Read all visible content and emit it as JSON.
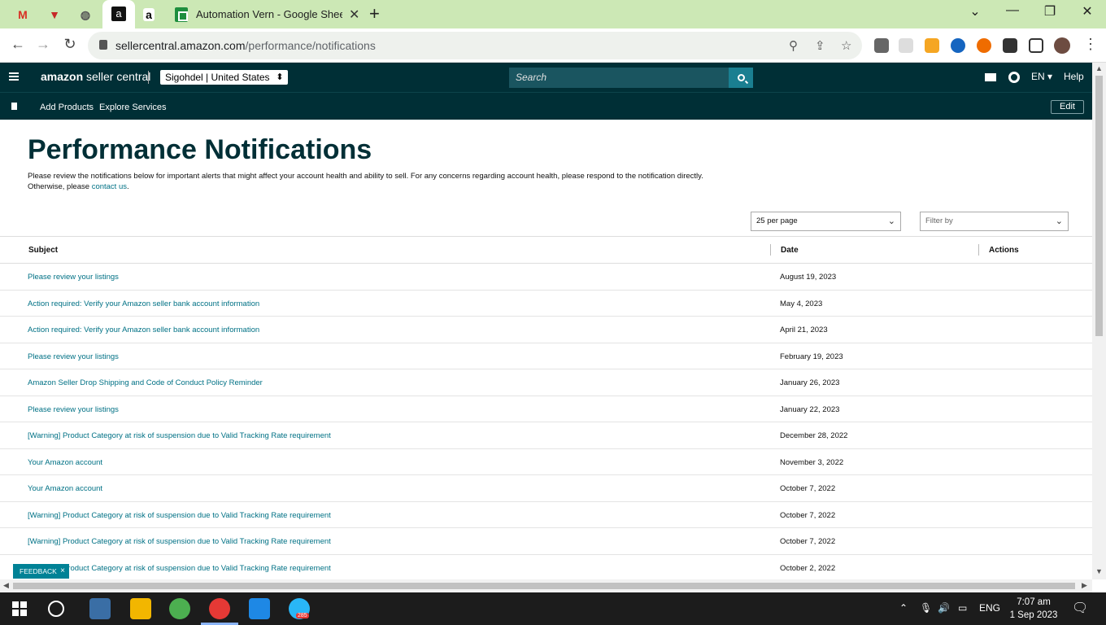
{
  "browser": {
    "tabs": [
      {
        "label": "M"
      },
      {
        "label": "▼"
      },
      {
        "label": "◍"
      },
      {
        "label": "a"
      },
      {
        "label": "a"
      },
      {
        "label": "Automation Vern - Google Sheets"
      }
    ],
    "url_host": "sellercentral.amazon.com",
    "url_path": "/performance/notifications"
  },
  "header": {
    "logo_main": "amazon",
    "logo_sub": " seller central",
    "account": "Sigohdel | United States",
    "search_placeholder": "Search",
    "language": "EN ▾",
    "help": "Help"
  },
  "nav": {
    "items": [
      "Add Products",
      "Explore Services"
    ],
    "edit": "Edit"
  },
  "page": {
    "title": "Performance Notifications",
    "intro": "Please review the notifications below for important alerts that might affect your account health and ability to sell. For any concerns regarding account health, please respond to the notification directly. Otherwise, please ",
    "contact_link": "contact us",
    "intro_end": ".",
    "per_page": "25 per page",
    "filter": "Filter by"
  },
  "table": {
    "headers": {
      "subject": "Subject",
      "date": "Date",
      "actions": "Actions"
    },
    "rows": [
      {
        "subject": "Please review your listings",
        "date": "August 19, 2023"
      },
      {
        "subject": "Action required: Verify your Amazon seller bank account information",
        "date": "May 4, 2023"
      },
      {
        "subject": "Action required: Verify your Amazon seller bank account information",
        "date": "April 21, 2023"
      },
      {
        "subject": "Please review your listings",
        "date": "February 19, 2023"
      },
      {
        "subject": "Amazon Seller Drop Shipping and Code of Conduct Policy Reminder",
        "date": "January 26, 2023"
      },
      {
        "subject": "Please review your listings",
        "date": "January 22, 2023"
      },
      {
        "subject": "[Warning] Product Category at risk of suspension due to Valid Tracking Rate requirement",
        "date": "December 28, 2022"
      },
      {
        "subject": "Your Amazon account",
        "date": "November 3, 2022"
      },
      {
        "subject": "Your Amazon account",
        "date": "October 7, 2022"
      },
      {
        "subject": "[Warning] Product Category at risk of suspension due to Valid Tracking Rate requirement",
        "date": "October 7, 2022"
      },
      {
        "subject": "[Warning] Product Category at risk of suspension due to Valid Tracking Rate requirement",
        "date": "October 7, 2022"
      },
      {
        "subject": "[Warning] Product Category at risk of suspension due to Valid Tracking Rate requirement",
        "date": "October 2, 2022"
      }
    ]
  },
  "feedback": {
    "label": "FEEDBACK",
    "close": "×"
  },
  "taskbar": {
    "telegram_badge": "285",
    "lang": "ENG",
    "time": "7:07 am",
    "date": "1 Sep 2023"
  },
  "colors": {
    "header_bg": "#002f36",
    "link": "#007185",
    "accent": "#008296"
  }
}
